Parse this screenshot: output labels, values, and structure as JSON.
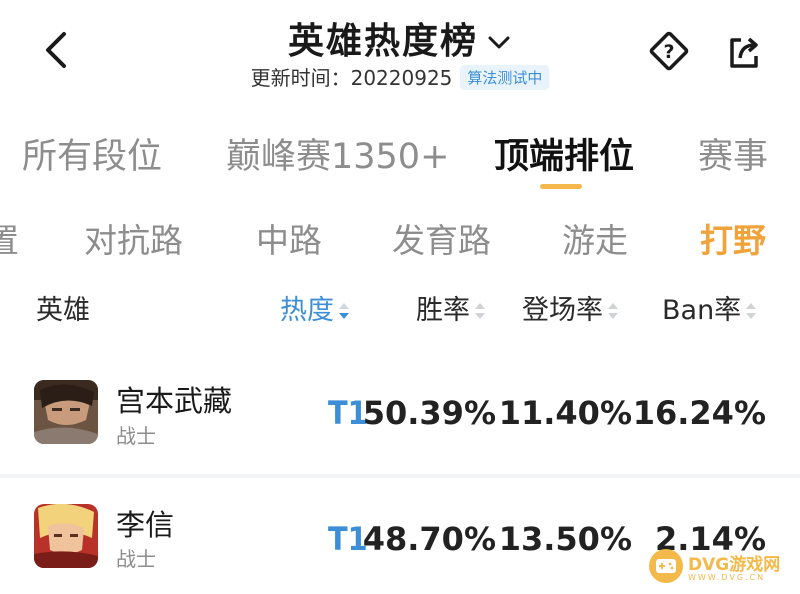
{
  "header": {
    "title": "英雄热度榜",
    "updated_label": "更新时间：20220925",
    "badge": "算法测试中"
  },
  "rank_tabs": [
    {
      "label": "所有段位",
      "active": false
    },
    {
      "label": "巅峰赛1350+",
      "active": false
    },
    {
      "label": "顶端排位",
      "active": true
    },
    {
      "label": "赛事",
      "active": false
    }
  ],
  "lane_tabs": [
    {
      "label": "置",
      "active": false
    },
    {
      "label": "对抗路",
      "active": false
    },
    {
      "label": "中路",
      "active": false
    },
    {
      "label": "发育路",
      "active": false
    },
    {
      "label": "游走",
      "active": false
    },
    {
      "label": "打野",
      "active": true
    }
  ],
  "columns": {
    "hero": "英雄",
    "heat": "热度",
    "win_rate": "胜率",
    "pick_rate": "登场率",
    "ban_rate": "Ban率"
  },
  "heroes": [
    {
      "name": "宫本武藏",
      "role": "战士",
      "tier": "T1",
      "win_rate": "50.39%",
      "pick_rate": "11.40%",
      "ban_rate": "16.24%"
    },
    {
      "name": "李信",
      "role": "战士",
      "tier": "T1",
      "win_rate": "48.70%",
      "pick_rate": "13.50%",
      "ban_rate": "2.14%"
    }
  ],
  "watermark": {
    "text": "DVG游戏网",
    "sub": "WWW.DVG.CN"
  },
  "colors": {
    "accent_blue": "#3c8fd7",
    "accent_orange": "#f0a33a",
    "tab_underline": "#f6b84b"
  },
  "icons": [
    "back-arrow-icon",
    "chevron-down-icon",
    "help-diamond-icon",
    "share-icon",
    "sort-icon",
    "gamepad-icon"
  ]
}
